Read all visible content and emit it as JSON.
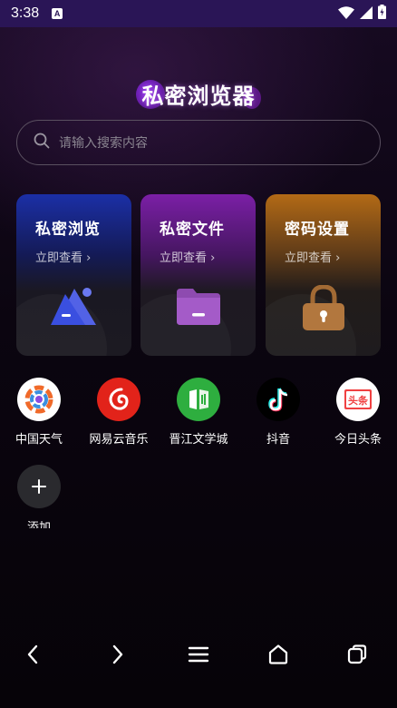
{
  "status_bar": {
    "time": "3:38",
    "notification_glyph": "A"
  },
  "title": "私密浏览器",
  "search": {
    "placeholder": "请输入搜索内容"
  },
  "cards": [
    {
      "title": "私密浏览",
      "subtitle": "立即查看 ›",
      "icon": "triangle-shapes-icon"
    },
    {
      "title": "私密文件",
      "subtitle": "立即查看 ›",
      "icon": "folder-icon"
    },
    {
      "title": "密码设置",
      "subtitle": "立即查看 ›",
      "icon": "lock-icon"
    }
  ],
  "apps": [
    {
      "label": "中国天气",
      "icon": "china-weather-icon",
      "color": "#ffffff"
    },
    {
      "label": "网易云音乐",
      "icon": "netease-music-icon",
      "color": "#e2231a"
    },
    {
      "label": "晋江文学城",
      "icon": "jinjiang-icon",
      "color": "#2eae3f"
    },
    {
      "label": "抖音",
      "icon": "douyin-icon",
      "color": "#000000"
    },
    {
      "label": "今日头条",
      "icon": "toutiao-icon",
      "color": "#ffffff"
    }
  ],
  "add_shortcut": {
    "label": "添加",
    "icon": "plus-icon"
  },
  "nav": [
    "back-icon",
    "forward-icon",
    "menu-icon",
    "home-icon",
    "tabs-icon"
  ]
}
